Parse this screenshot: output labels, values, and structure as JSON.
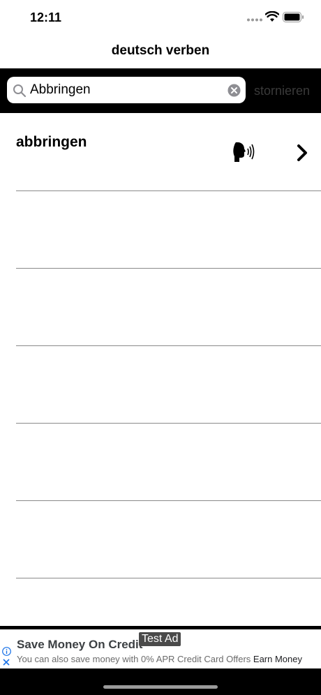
{
  "status_bar": {
    "time": "12:11"
  },
  "nav": {
    "title": "deutsch verben"
  },
  "search": {
    "value": "Abbringen",
    "cancel_label": "stornieren"
  },
  "results": [
    {
      "word": "abbringen"
    }
  ],
  "ad": {
    "headline": "Save Money On Credit",
    "badge": "Test Ad",
    "body": "You can also save money with 0% APR Credit Card Offers",
    "cta": "Earn Money"
  },
  "colors": {
    "search_bar_bg": "#000000",
    "ad_icon": "#1a73e8"
  }
}
